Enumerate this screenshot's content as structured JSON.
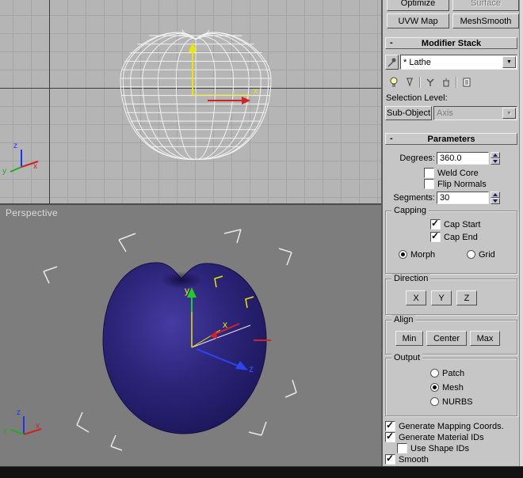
{
  "viewport_top": {
    "gizmo_x_label": "x",
    "tripod": {
      "x": "x",
      "y": "y",
      "z": "z"
    }
  },
  "viewport_persp": {
    "label": "Perspective",
    "gizmo": {
      "x": "x",
      "y": "y",
      "z": "z"
    },
    "tripod": {
      "x": "x",
      "y": "y",
      "z": "z"
    }
  },
  "panel": {
    "buttons_row1": [
      {
        "label": "Optimize",
        "enabled": true
      },
      {
        "label": "Surface",
        "enabled": false
      }
    ],
    "buttons_row2": [
      {
        "label": "UVW Map",
        "enabled": true
      },
      {
        "label": "MeshSmooth",
        "enabled": true
      }
    ],
    "modifier_stack": {
      "collapse": "-",
      "title": "Modifier Stack",
      "stack_value": "* Lathe",
      "selection_level": "Selection Level:",
      "sub_object": "Sub-Object",
      "axis_value": "Axis"
    },
    "parameters": {
      "collapse": "-",
      "title": "Parameters",
      "degrees_label": "Degrees:",
      "degrees_value": "360.0",
      "weld_core": {
        "label": "Weld Core",
        "checked": false
      },
      "flip_normals": {
        "label": "Flip Normals",
        "checked": false
      },
      "segments_label": "Segments:",
      "segments_value": "30",
      "capping": {
        "title": "Capping",
        "cap_start": {
          "label": "Cap Start",
          "checked": true
        },
        "cap_end": {
          "label": "Cap End",
          "checked": true
        },
        "morph": {
          "label": "Morph",
          "selected": true
        },
        "grid": {
          "label": "Grid",
          "selected": false
        }
      },
      "direction": {
        "title": "Direction",
        "x": "X",
        "y": "Y",
        "z": "Z"
      },
      "align": {
        "title": "Align",
        "min": "Min",
        "center": "Center",
        "max": "Max"
      },
      "output": {
        "title": "Output",
        "patch": {
          "label": "Patch",
          "selected": false
        },
        "mesh": {
          "label": "Mesh",
          "selected": true
        },
        "nurbs": {
          "label": "NURBS",
          "selected": false
        }
      },
      "gen_mapping": {
        "label": "Generate Mapping Coords.",
        "checked": true
      },
      "gen_material": {
        "label": "Generate Material IDs",
        "checked": true
      },
      "use_shape_ids": {
        "label": "Use Shape IDs",
        "checked": false
      },
      "smooth": {
        "label": "Smooth",
        "checked": true
      }
    }
  },
  "colors": {
    "apple_fill": "#2c2478",
    "wireframe": "#f2f2f2",
    "viewport_top_bg": "#b5b5b5",
    "viewport_persp_bg": "#7d7d7d",
    "panel_bg": "#c6c6c6"
  }
}
